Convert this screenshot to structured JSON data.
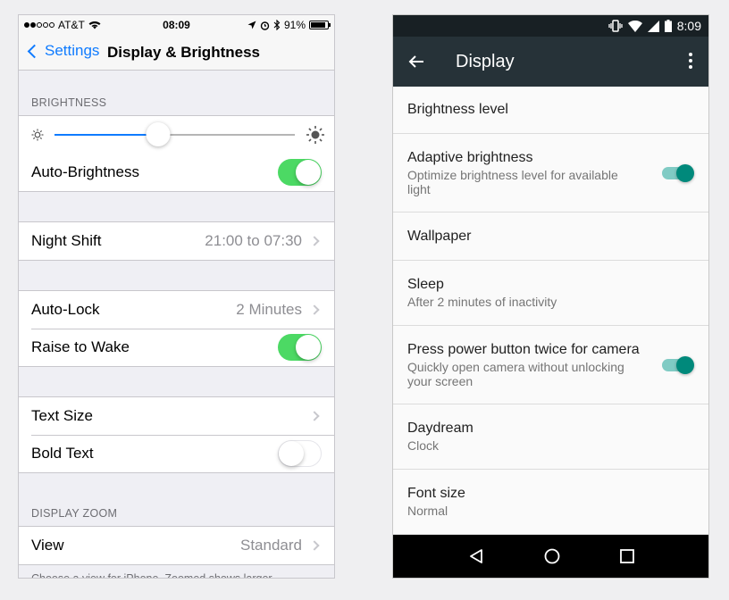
{
  "ios": {
    "status": {
      "carrier": "AT&T",
      "time": "08:09",
      "battery": "91%",
      "battery_level": 0.91
    },
    "nav": {
      "back_label": "Settings",
      "title": "Display & Brightness"
    },
    "brightness_header": "BRIGHTNESS",
    "brightness_level": 0.43,
    "auto_brightness": {
      "label": "Auto-Brightness",
      "on": true
    },
    "night_shift": {
      "label": "Night Shift",
      "value": "21:00 to 07:30"
    },
    "auto_lock": {
      "label": "Auto-Lock",
      "value": "2 Minutes"
    },
    "raise_to_wake": {
      "label": "Raise to Wake",
      "on": true
    },
    "text_size": {
      "label": "Text Size"
    },
    "bold_text": {
      "label": "Bold Text",
      "on": false
    },
    "display_zoom_header": "DISPLAY ZOOM",
    "view": {
      "label": "View",
      "value": "Standard"
    },
    "zoom_footnote": "Choose a view for iPhone. Zoomed shows larger",
    "colors": {
      "accent": "#0f7bff",
      "toggle_on": "#4cd964"
    }
  },
  "android": {
    "status": {
      "time": "8:09"
    },
    "toolbar": {
      "title": "Display"
    },
    "items": [
      {
        "title": "Brightness level",
        "subtitle": ""
      },
      {
        "title": "Adaptive brightness",
        "subtitle": "Optimize brightness level for available light",
        "switch_on": true
      },
      {
        "title": "Wallpaper",
        "subtitle": ""
      },
      {
        "title": "Sleep",
        "subtitle": "After 2 minutes of inactivity"
      },
      {
        "title": "Press power button twice for camera",
        "subtitle": "Quickly open camera without unlocking your screen",
        "switch_on": true
      },
      {
        "title": "Daydream",
        "subtitle": "Clock"
      },
      {
        "title": "Font size",
        "subtitle": "Normal"
      }
    ],
    "colors": {
      "toolbar": "#263238",
      "accent": "#00897b"
    }
  }
}
